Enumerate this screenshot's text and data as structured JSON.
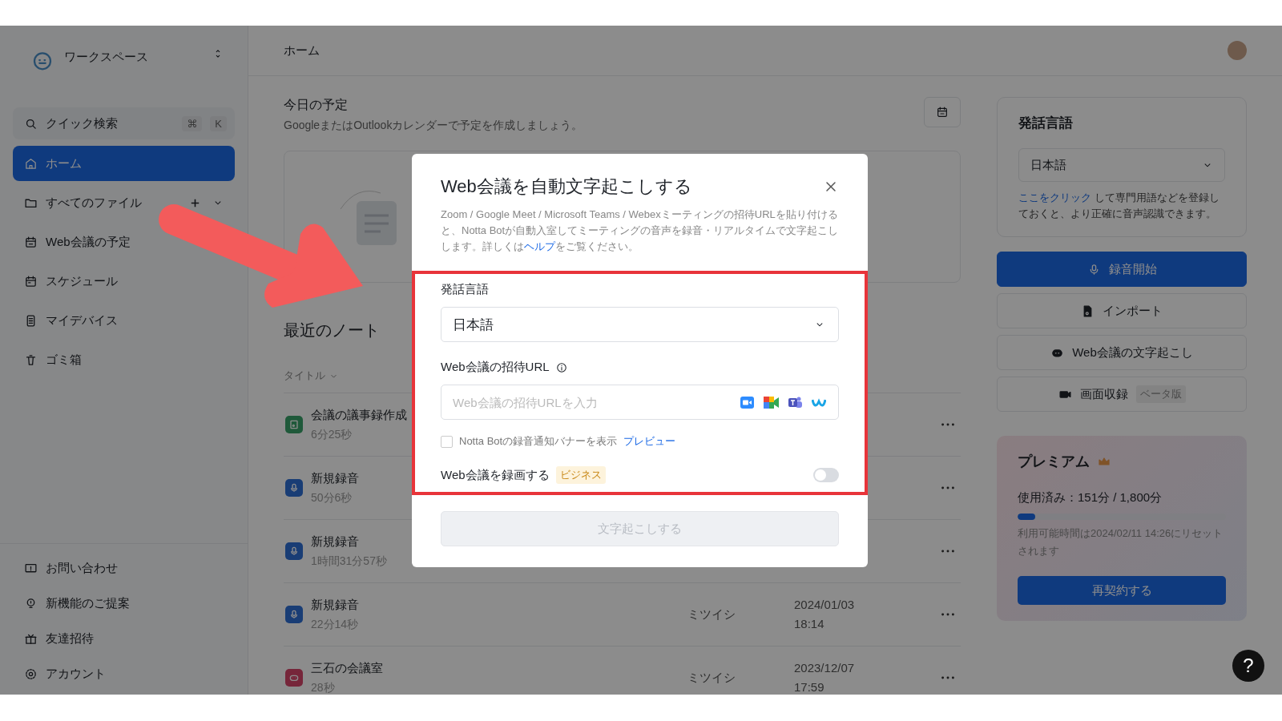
{
  "sidebar": {
    "workspace": "ワークスペース",
    "search": {
      "label": "クイック検索",
      "keys": [
        "⌘",
        "K"
      ]
    },
    "items": [
      {
        "label": "ホーム",
        "selected": true,
        "expandable": false
      },
      {
        "label": "すべてのファイル",
        "selected": false,
        "expandable": true
      },
      {
        "label": "Web会議の予定",
        "selected": false,
        "expandable": false
      },
      {
        "label": "スケジュール",
        "selected": false,
        "expandable": false
      },
      {
        "label": "マイデバイス",
        "selected": false,
        "expandable": false
      },
      {
        "label": "ゴミ箱",
        "selected": false,
        "expandable": false
      }
    ],
    "bottom_items": [
      "お問い合わせ",
      "新機能のご提案",
      "友達招待",
      "アカウント"
    ]
  },
  "header": {
    "title": "ホーム"
  },
  "today": {
    "title": "今日の予定",
    "subtitle": "GoogleまたはOutlookカレンダーで予定を作成しましょう。"
  },
  "notes": {
    "title": "最近のノート",
    "sort_label": "タイトル",
    "rows": [
      {
        "kind": "import",
        "title": "会議の議事録作成",
        "duration": "6分25秒"
      },
      {
        "kind": "recording",
        "title": "新規録音",
        "duration": "50分6秒"
      },
      {
        "kind": "recording",
        "title": "新規録音",
        "duration": "1時間31分57秒"
      },
      {
        "kind": "recording",
        "title": "新規録音",
        "duration": "22分14秒",
        "owner": "ミツイシ",
        "date": "2024/01/03",
        "time": "18:14"
      },
      {
        "kind": "meeting",
        "title": "三石の会議室",
        "duration": "28秒",
        "owner": "ミツイシ",
        "date": "2023/12/07",
        "time": "17:59"
      }
    ]
  },
  "right": {
    "language_card": {
      "title": "発話言語",
      "value": "日本語",
      "link": "ここをクリック",
      "hint": " して専門用語などを登録しておくと、より正確に音声認識できます。"
    },
    "buttons": [
      {
        "kind": "primary",
        "label": "録音開始"
      },
      {
        "kind": "plain",
        "label": "インポート"
      },
      {
        "kind": "plain",
        "label": "Web会議の文字起こし"
      },
      {
        "kind": "plain",
        "label": "画面収録",
        "badge": "ベータ版"
      }
    ],
    "premium": {
      "title": "プレミアム",
      "usage": "使用済み：151分 / 1,800分",
      "level": 0.084,
      "reset_note": "利用可能時間は2024/02/11 14:26にリセットされます",
      "button": "再契約する"
    },
    "help": "?"
  },
  "dialog": {
    "title": "Web会議を自動文字起こしする",
    "description": {
      "before": "Zoom / Google Meet / Microsoft Teams / Webexミーティングの招待URLを貼り付けると、Notta Botが自動入室してミーティングの音声を録音・リアルタイムで文字起こしします。詳しくは",
      "link": "ヘルプ",
      "after": "をご覧ください。"
    },
    "language_label": "発話言語",
    "language_value": "日本語",
    "url_label": "Web会議の招待URL",
    "url_placeholder": "Web会議の招待URLを入力",
    "banner": {
      "label": "Notta Botの録音通知バナーを表示",
      "link": "プレビュー",
      "checked": false
    },
    "record": {
      "label": "Web会議を録画する",
      "badge": "ビジネス",
      "on": false
    },
    "submit": {
      "label": "文字起こしする",
      "disabled": true
    }
  }
}
